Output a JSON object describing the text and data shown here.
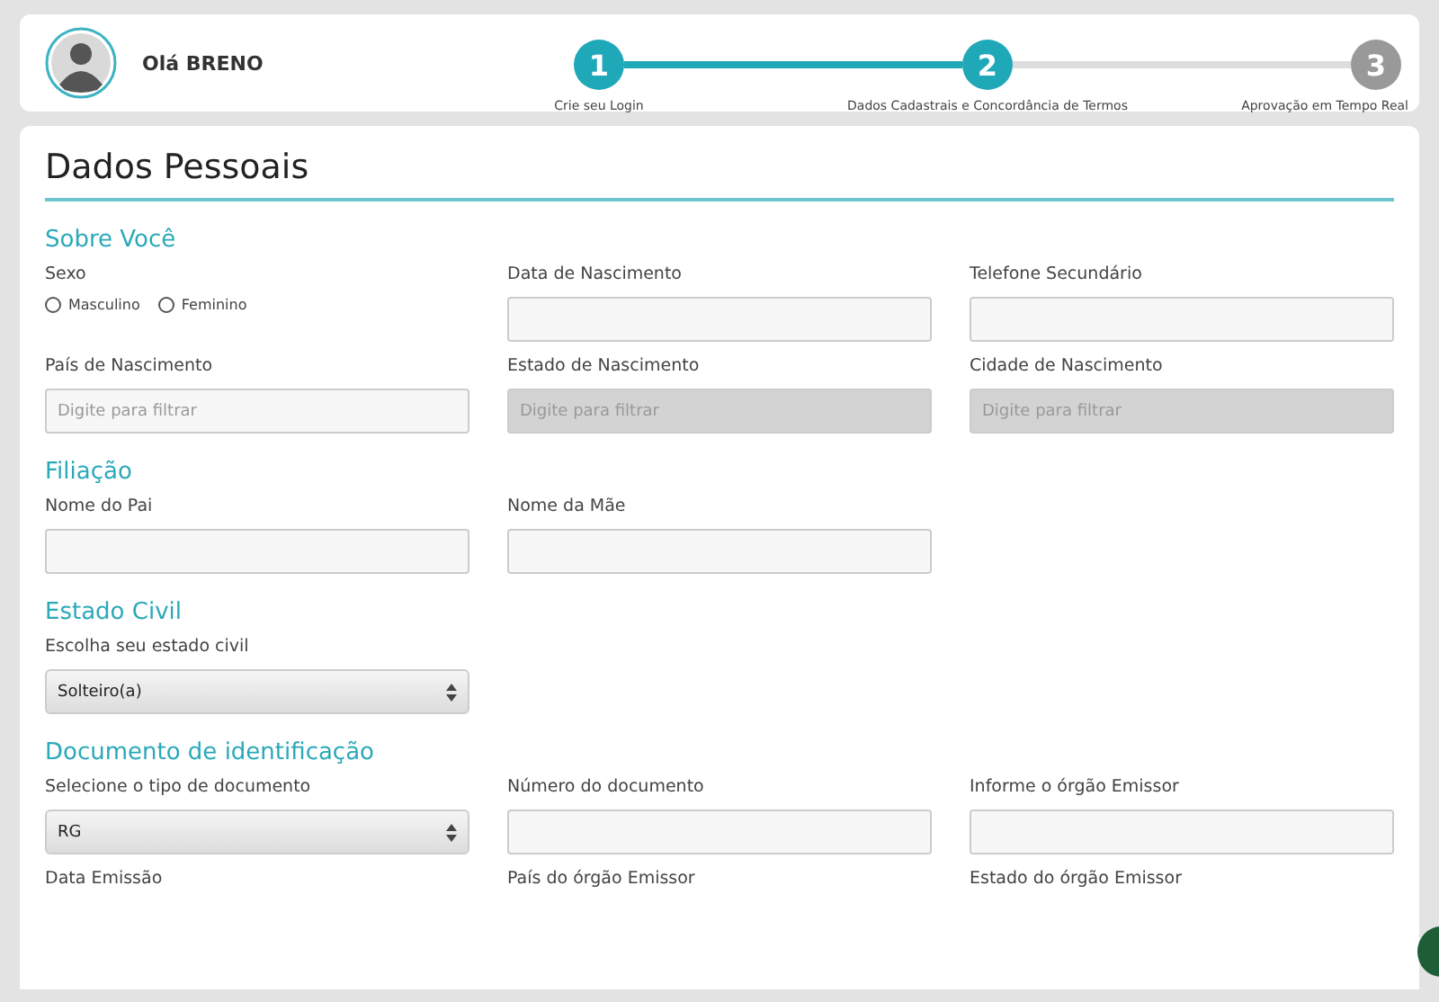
{
  "header": {
    "greeting": "Olá BRENO",
    "steps": [
      {
        "number": "1",
        "label": "Crie seu Login",
        "completed": true
      },
      {
        "number": "2",
        "label": "Dados Cadastrais e Concordância de Termos",
        "completed": true
      },
      {
        "number": "3",
        "label": "Aprovação em Tempo Real",
        "completed": false
      }
    ]
  },
  "page_title": "Dados Pessoais",
  "sections": [
    {
      "title": "Sobre Você",
      "rows": [
        [
          {
            "kind": "radio",
            "label": "Sexo",
            "options": [
              {
                "label": "Masculino",
                "selected": false
              },
              {
                "label": "Feminino",
                "selected": false
              }
            ]
          },
          {
            "kind": "input",
            "label": "Data de Nascimento",
            "disabled": false
          },
          {
            "kind": "input",
            "label": "Telefone Secundário",
            "disabled": false
          }
        ],
        [
          {
            "kind": "input",
            "label": "País de Nascimento",
            "placeholder": "Digite para filtrar",
            "disabled": false
          },
          {
            "kind": "input",
            "label": "Estado de Nascimento",
            "placeholder": "Digite para filtrar",
            "disabled": true
          },
          {
            "kind": "input",
            "label": "Cidade de Nascimento",
            "placeholder": "Digite para filtrar",
            "disabled": true
          }
        ]
      ]
    },
    {
      "title": "Filiação",
      "rows": [
        [
          {
            "kind": "input",
            "label": "Nome do Pai",
            "disabled": false
          },
          {
            "kind": "input",
            "label": "Nome da Mãe",
            "disabled": false
          }
        ]
      ]
    },
    {
      "title": "Estado Civil",
      "rows": [
        [
          {
            "kind": "select",
            "label": "Escolha seu estado civil",
            "value": "Solteiro(a)"
          }
        ]
      ]
    },
    {
      "title": "Documento de identificação",
      "rows": [
        [
          {
            "kind": "select",
            "label": "Selecione o tipo de documento",
            "value": "RG"
          },
          {
            "kind": "input",
            "label": "Número do documento",
            "disabled": false
          },
          {
            "kind": "input",
            "label": "Informe o órgão Emissor",
            "disabled": false
          }
        ],
        [
          {
            "kind": "label",
            "label": "Data Emissão"
          },
          {
            "kind": "label",
            "label": "País do órgão Emissor"
          },
          {
            "kind": "label",
            "label": "Estado do órgão Emissor"
          }
        ]
      ]
    }
  ]
}
